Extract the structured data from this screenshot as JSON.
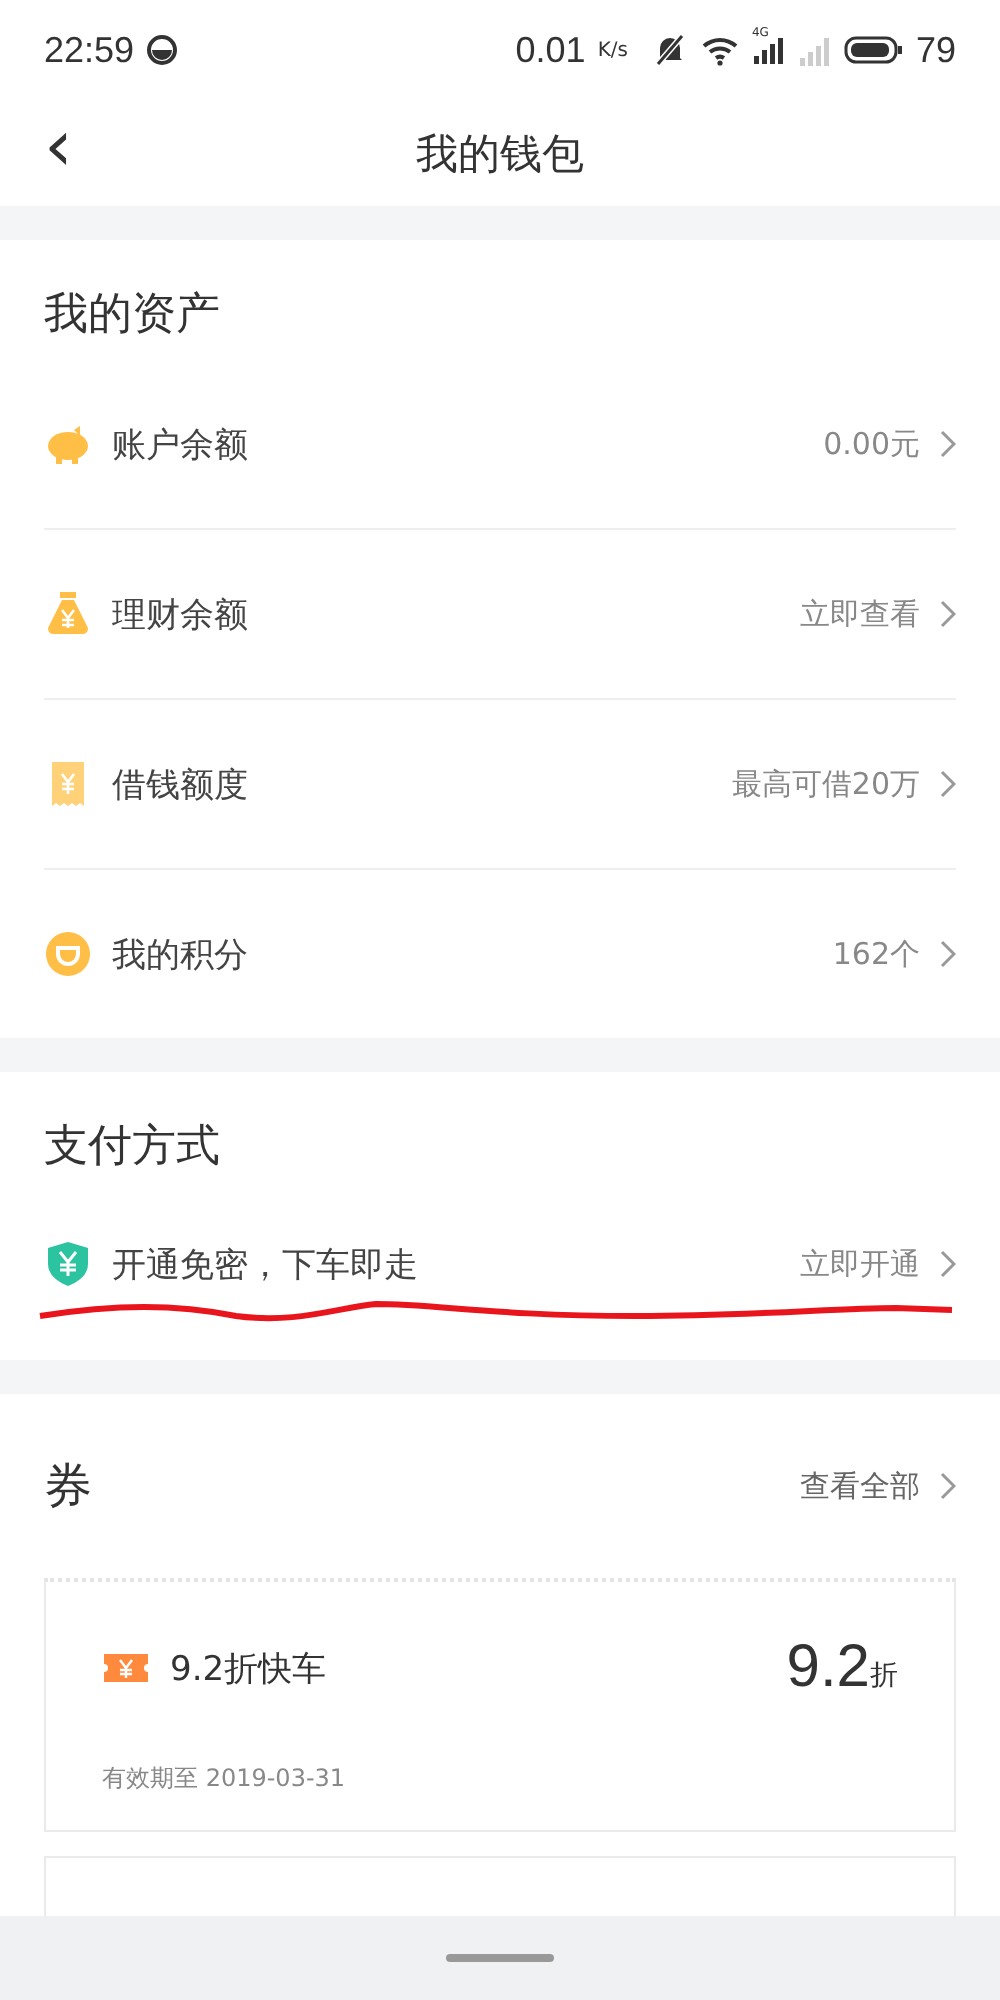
{
  "status_bar": {
    "time": "22:59",
    "speed": "0.01",
    "speed_unit": "K/s",
    "network": "4G",
    "battery": "79"
  },
  "header": {
    "back": "‹",
    "title": "我的钱包"
  },
  "assets": {
    "title": "我的资产",
    "items": [
      {
        "kind": "piggy",
        "label": "账户余额",
        "value": "0.00元"
      },
      {
        "kind": "moneybag",
        "label": "理财余额",
        "value": "立即查看"
      },
      {
        "kind": "receipt",
        "label": "借钱额度",
        "value": "最高可借20万"
      },
      {
        "kind": "points",
        "label": "我的积分",
        "value": "162个"
      }
    ]
  },
  "payment": {
    "title": "支付方式",
    "items": [
      {
        "kind": "shield",
        "label": "开通免密，下车即走",
        "value": "立即开通"
      }
    ]
  },
  "coupons": {
    "title": "券",
    "view_all": "查看全部",
    "items": [
      {
        "name": "9.2折快车",
        "discount": "9.2",
        "unit": "折",
        "validity": "有效期至 2019-03-31"
      }
    ]
  }
}
